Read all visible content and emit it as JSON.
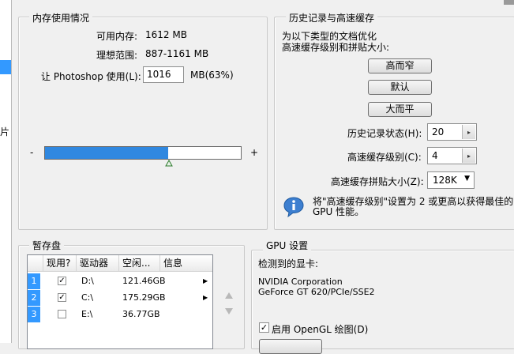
{
  "memory": {
    "title": "内存使用情况",
    "available_label": "可用内存:",
    "available_value": "1612 MB",
    "ideal_label": "理想范围:",
    "ideal_value": "887-1161 MB",
    "let_label": "让 Photoshop 使用(L):",
    "let_value": "1016",
    "let_unit": "MB(63%)",
    "minus": "-",
    "plus": "+",
    "slider_percent": 63
  },
  "history": {
    "title": "历史记录与高速缓存",
    "desc_line1": "为以下类型的文档优化",
    "desc_line2": "高速缓存级别和拼贴大小:",
    "btn_tall": "高而窄",
    "btn_default": "默认",
    "btn_wide": "大而平",
    "states_label": "历史记录状态(H):",
    "states_value": "20",
    "levels_label": "高速缓存级别(C):",
    "levels_value": "4",
    "tile_label": "高速缓存拼贴大小(Z):",
    "tile_value": "128K",
    "tip_line1": "将\"高速缓存级别\"设置为 2 或更高以获得最佳的",
    "tip_line2": "GPU 性能。"
  },
  "scratch": {
    "title": "暂存盘",
    "headers": [
      "现用?",
      "驱动器",
      "空闲...",
      "信息"
    ],
    "rows": [
      {
        "num": "1",
        "checked": "✓",
        "drive": "D:\\",
        "free": "121.46GB"
      },
      {
        "num": "2",
        "checked": "✓",
        "drive": "C:\\",
        "free": "175.29GB"
      },
      {
        "num": "3",
        "checked": "",
        "drive": "E:\\",
        "free": "36.77GB"
      }
    ]
  },
  "gpu": {
    "title": "GPU 设置",
    "detected_label": "检测到的显卡:",
    "card_line1": "NVIDIA Corporation",
    "card_line2": "GeForce GT 620/PCIe/SSE2",
    "opengl_check": "✓",
    "opengl_label": "启用 OpenGL 绘图(D)"
  },
  "left_panel": {
    "partial_text": "片"
  }
}
